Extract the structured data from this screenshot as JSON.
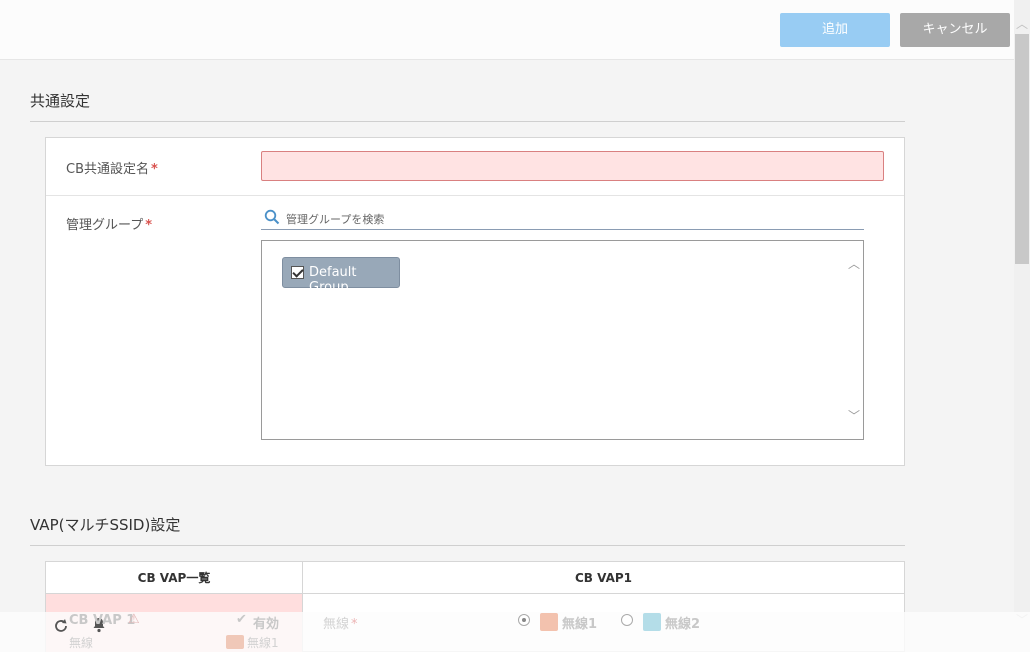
{
  "toolbar": {
    "add_label": "追加",
    "cancel_label": "キャンセル"
  },
  "common": {
    "title": "共通設定",
    "name_label": "CB共通設定名",
    "group_label": "管理グループ",
    "required_mark": "*",
    "search_placeholder": "管理グループを検索",
    "groups": [
      {
        "label": "Default Group",
        "checked": true
      }
    ]
  },
  "vap": {
    "title": "VAP(マルチSSID)設定",
    "list_header": "CB VAP一覧",
    "detail_header": "CB VAP1",
    "item": {
      "name": "CB VAP 1",
      "status": "有効",
      "sub": "無線",
      "radio_tag": "無線1"
    },
    "radio_label": "無線",
    "radio_options": [
      "無線1",
      "無線2"
    ]
  },
  "colors": {
    "primary": "#98ccf3",
    "cancel": "#a8a8a8",
    "error_bg": "#ffe3e3",
    "chip": "#98a8b8"
  }
}
